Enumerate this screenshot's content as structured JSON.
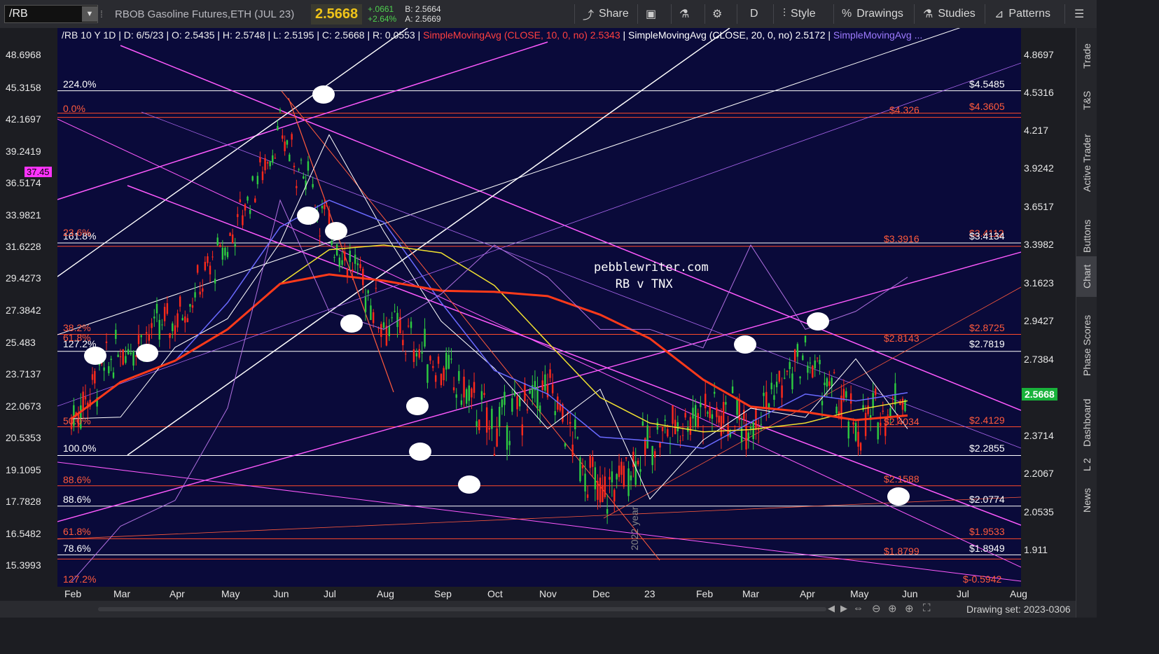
{
  "toolbar": {
    "symbol": "/RB",
    "instrument": "RBOB Gasoline Futures,ETH (JUL 23)",
    "last": "2.5668",
    "change": "+.0661",
    "change_pct": "+2.64%",
    "bid": "B: 2.5664",
    "ask": "A: 2.5669",
    "share": "Share",
    "period": "D",
    "style": "Style",
    "drawings": "Drawings",
    "studies": "Studies",
    "patterns": "Patterns"
  },
  "legend": {
    "symbol": "/RB 10 Y 1D",
    "date": "D: 6/5/23",
    "open": "O: 2.5435",
    "high": "H: 2.5748",
    "low": "L: 2.5195",
    "close": "C: 2.5668",
    "range": "R: 0.0553",
    "sma10": "SimpleMovingAvg (CLOSE, 10, 0, no)",
    "sma10_val": "2.5343",
    "sma20": "SimpleMovingAvg (CLOSE, 20, 0, no)",
    "sma20_val": "2.5172",
    "sma_more": "SimpleMovingAvg ..."
  },
  "left_axis": [
    "48.6968",
    "45.3158",
    "42.1697",
    "39.2419",
    "36.5174",
    "33.9821",
    "31.6228",
    "29.4273",
    "27.3842",
    "25.483",
    "23.7137",
    "22.0673",
    "20.5353",
    "19.1095",
    "17.7828",
    "16.5482",
    "15.3993"
  ],
  "right_axis": [
    "4.8697",
    "4.5316",
    "4.217",
    "3.9242",
    "3.6517",
    "3.3982",
    "3.1623",
    "2.9427",
    "2.7384",
    "2.5403",
    "2.3714",
    "2.2067",
    "2.0535",
    "1.911"
  ],
  "x_axis": [
    "Feb",
    "Mar",
    "Apr",
    "May",
    "Jun",
    "Jul",
    "Aug",
    "Sep",
    "Oct",
    "Nov",
    "Dec",
    "23",
    "Feb",
    "Mar",
    "Apr",
    "May",
    "Jun",
    "Jul",
    "Aug"
  ],
  "fib_left": [
    "224.0%",
    "0.0%",
    "161.8%",
    "38.2%",
    "127.2%",
    "50.0%",
    "100.0%",
    "88.6%",
    "61.8%",
    "78.6%",
    "127.2%",
    "23.6%",
    "61.8%",
    "88.6%"
  ],
  "fib_right_red": [
    "$4.326",
    "$3.3916",
    "$2.8143",
    "$2.4034",
    "$2.1588",
    "$1.8799",
    "$-0.5942"
  ],
  "price_levels_right": [
    "$4.5485",
    "$4.3605",
    "$3.4112",
    "$3.4134",
    "$2.8725",
    "$2.7819",
    "$2.4129",
    "$2.2855",
    "$2.0774",
    "$1.9533",
    "$1.8949"
  ],
  "current_price_tag": "2.5668",
  "oscillator_tag": "37.45",
  "watermark": [
    "pebblewriter.com",
    "RB v TNX"
  ],
  "year_mark": "2022 year",
  "drawing_set": "Drawing set: 2023-0306",
  "side_tabs": [
    "Trade",
    "T&S",
    "Active Trader",
    "Buttons",
    "Chart",
    "Phase Scores",
    "Dashboard",
    "L 2",
    "News"
  ],
  "colors": {
    "chart_bg": "#0a0a3a",
    "up": "#2ecc40",
    "down": "#ff2a1a",
    "fib_red": "#ff5a3c",
    "magenta": "#ff5aff",
    "price_tag": "#19b23b"
  },
  "chart_data": {
    "type": "line",
    "title": "",
    "xlabel": "",
    "ylabel": "",
    "categories": [
      "Feb",
      "Mar",
      "Apr",
      "May",
      "Jun",
      "Jul",
      "Aug",
      "Sep",
      "Oct",
      "Nov",
      "Dec",
      "23",
      "Feb",
      "Mar",
      "Apr",
      "May",
      "Jun"
    ],
    "series": [
      {
        "values": [
          2.45,
          2.8,
          2.95,
          3.4,
          4.2,
          3.5,
          2.95,
          2.7,
          2.4,
          2.6,
          2.1,
          2.35,
          2.5,
          2.45,
          2.75,
          2.4,
          2.57
        ]
      },
      {
        "values": [
          1.8,
          2.0,
          2.1,
          2.5,
          3.7,
          3.0,
          2.9,
          3.1,
          3.4,
          3.2,
          2.9,
          2.9,
          2.8,
          3.4,
          2.9,
          3.0,
          3.2
        ]
      }
    ]
  }
}
